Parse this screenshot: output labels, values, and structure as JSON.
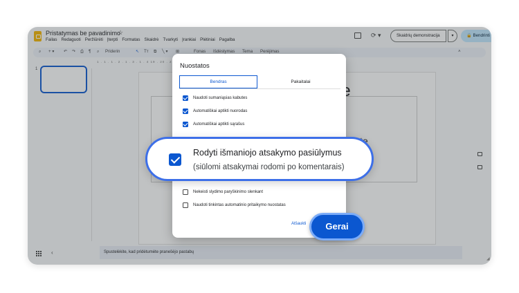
{
  "window": {
    "doc_title": "Pristatymas be pavadinimo",
    "menu": [
      "Failas",
      "Redaguoti",
      "Peržiūrėti",
      "Įterpti",
      "Formatas",
      "Skaidrė",
      "Tvarkyti",
      "Įrankiai",
      "Plėtiniai",
      "Pagalba"
    ],
    "slideshow_label": "Skaidrių demonstracija",
    "share_label": "Bendrinti",
    "avatar_letter": "A",
    "toolbar": {
      "fit_label": "Priderin",
      "background_label": "Fonas",
      "layout_label": "Išdėstymas",
      "theme_label": "Tema",
      "transition_label": "Perėjimas"
    },
    "ruler_text": "1 . 1 . 1 . 2 . 1 . 3 . 1 . 4      19 . 20 . 21 . 22 . 23 . 24 . 25",
    "slide_number": "1",
    "slide_text_1": "orite",
    "slide_text_2": "istę",
    "notes_placeholder": "Spustelėkite, kad pridėtumėte pranešėjo pastabų"
  },
  "dialog": {
    "title": "Nuostatos",
    "tabs": [
      {
        "label": "Bendras",
        "active": true
      },
      {
        "label": "Pakaitalai",
        "active": false
      }
    ],
    "options": [
      {
        "label": "Naudoti sumaniąsias kabutes",
        "checked": true
      },
      {
        "label": "Automatiškai aptikti nuorodas",
        "checked": true
      },
      {
        "label": "Automatiškai aptikti sąrašus",
        "checked": true
      },
      {
        "label": "Nekeisti slydimo paryškinimo slenkant",
        "checked": false
      },
      {
        "label": "Naudoti tinkintas automatinio pritaikymo nuostatas",
        "checked": false
      }
    ],
    "cancel_label": "Atšaukti",
    "ok_label": "Gerai"
  },
  "callout": {
    "line1": "Rodyti išmaniojo atsakymo pasiūlymus",
    "line2": "(siūlomi atsakymai rodomi po komentarais)",
    "checked": true
  },
  "colors": {
    "accent": "#0b57d0",
    "callout_border": "#3d6fe8",
    "share_bg": "#c2e7ff"
  }
}
